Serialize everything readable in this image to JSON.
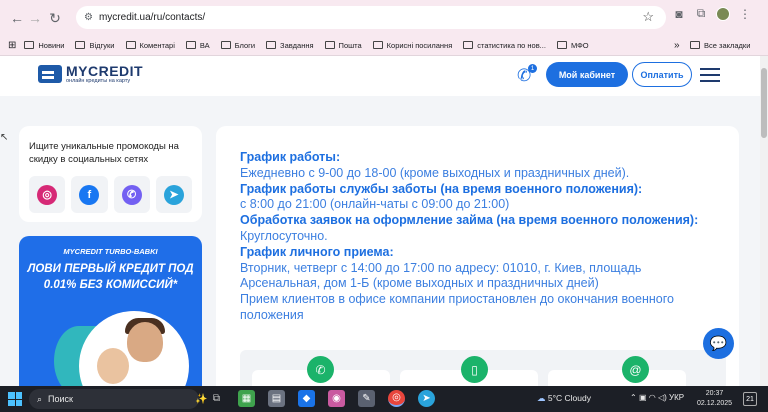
{
  "browser": {
    "url": "mycredit.ua/ru/contacts/",
    "bookmarks": [
      "Новини",
      "Відгуки",
      "Коментарі",
      "ВА",
      "Блоги",
      "Завдання",
      "Пошта",
      "Корисні посилання",
      "статистика по нов...",
      "МФО"
    ],
    "more": "»",
    "all_bookmarks": "Все закладки"
  },
  "header": {
    "logo_title": "MYCREDIT",
    "logo_sub": "онлайн кредиты на карту",
    "phone_badge": "1",
    "cabinet_button": "Мой кабинет",
    "pay_button": "Оплатить"
  },
  "sidebar": {
    "promo_text": "Ищите уникальные промокоды на скидку в социальных сетях",
    "socials": [
      {
        "name": "instagram-icon",
        "glyph": "◎",
        "color": "#d62976"
      },
      {
        "name": "facebook-icon",
        "glyph": "f",
        "color": "#1877f2"
      },
      {
        "name": "viber-icon",
        "glyph": "✆",
        "color": "#7360f2"
      },
      {
        "name": "telegram-icon",
        "glyph": "➤",
        "color": "#2aa3db"
      }
    ],
    "banner_top": "MYCREDIT TURBO-BABKI",
    "banner_main": "ЛОВИ ПЕРВЫЙ КРЕДИТ ПОД 0.01% БЕЗ КОМИССИЙ*"
  },
  "info": {
    "h1": "График работы:",
    "t1": "Ежедневно с 9-00 до 18-00 (кроме выходных и праздничных дней).",
    "h2": "График работы службы заботы (на время военного положения):",
    "t2": "с 8:00 до 21:00 (онлайн-чаты с 09:00 до 21:00)",
    "h3": "Обработка заявок на оформление займа (на время военного положения):",
    "t3": "Круглосуточно.",
    "h4": "График личного приема:",
    "t4": "Вторник, четверг с 14:00 до 17:00 по адресу: 01010, г. Киев, площадь Арсенальная, дом 1-Б (кроме выходных и праздничных дней)",
    "t5": "Прием клиентов в офисе компании приостановлен до окончания военного положения"
  },
  "taskbar": {
    "search_placeholder": "Поиск",
    "weather": "5°C  Cloudy",
    "lang": "УКР",
    "time": "20:37",
    "date": "02.12.2025",
    "notif_count": "21"
  }
}
